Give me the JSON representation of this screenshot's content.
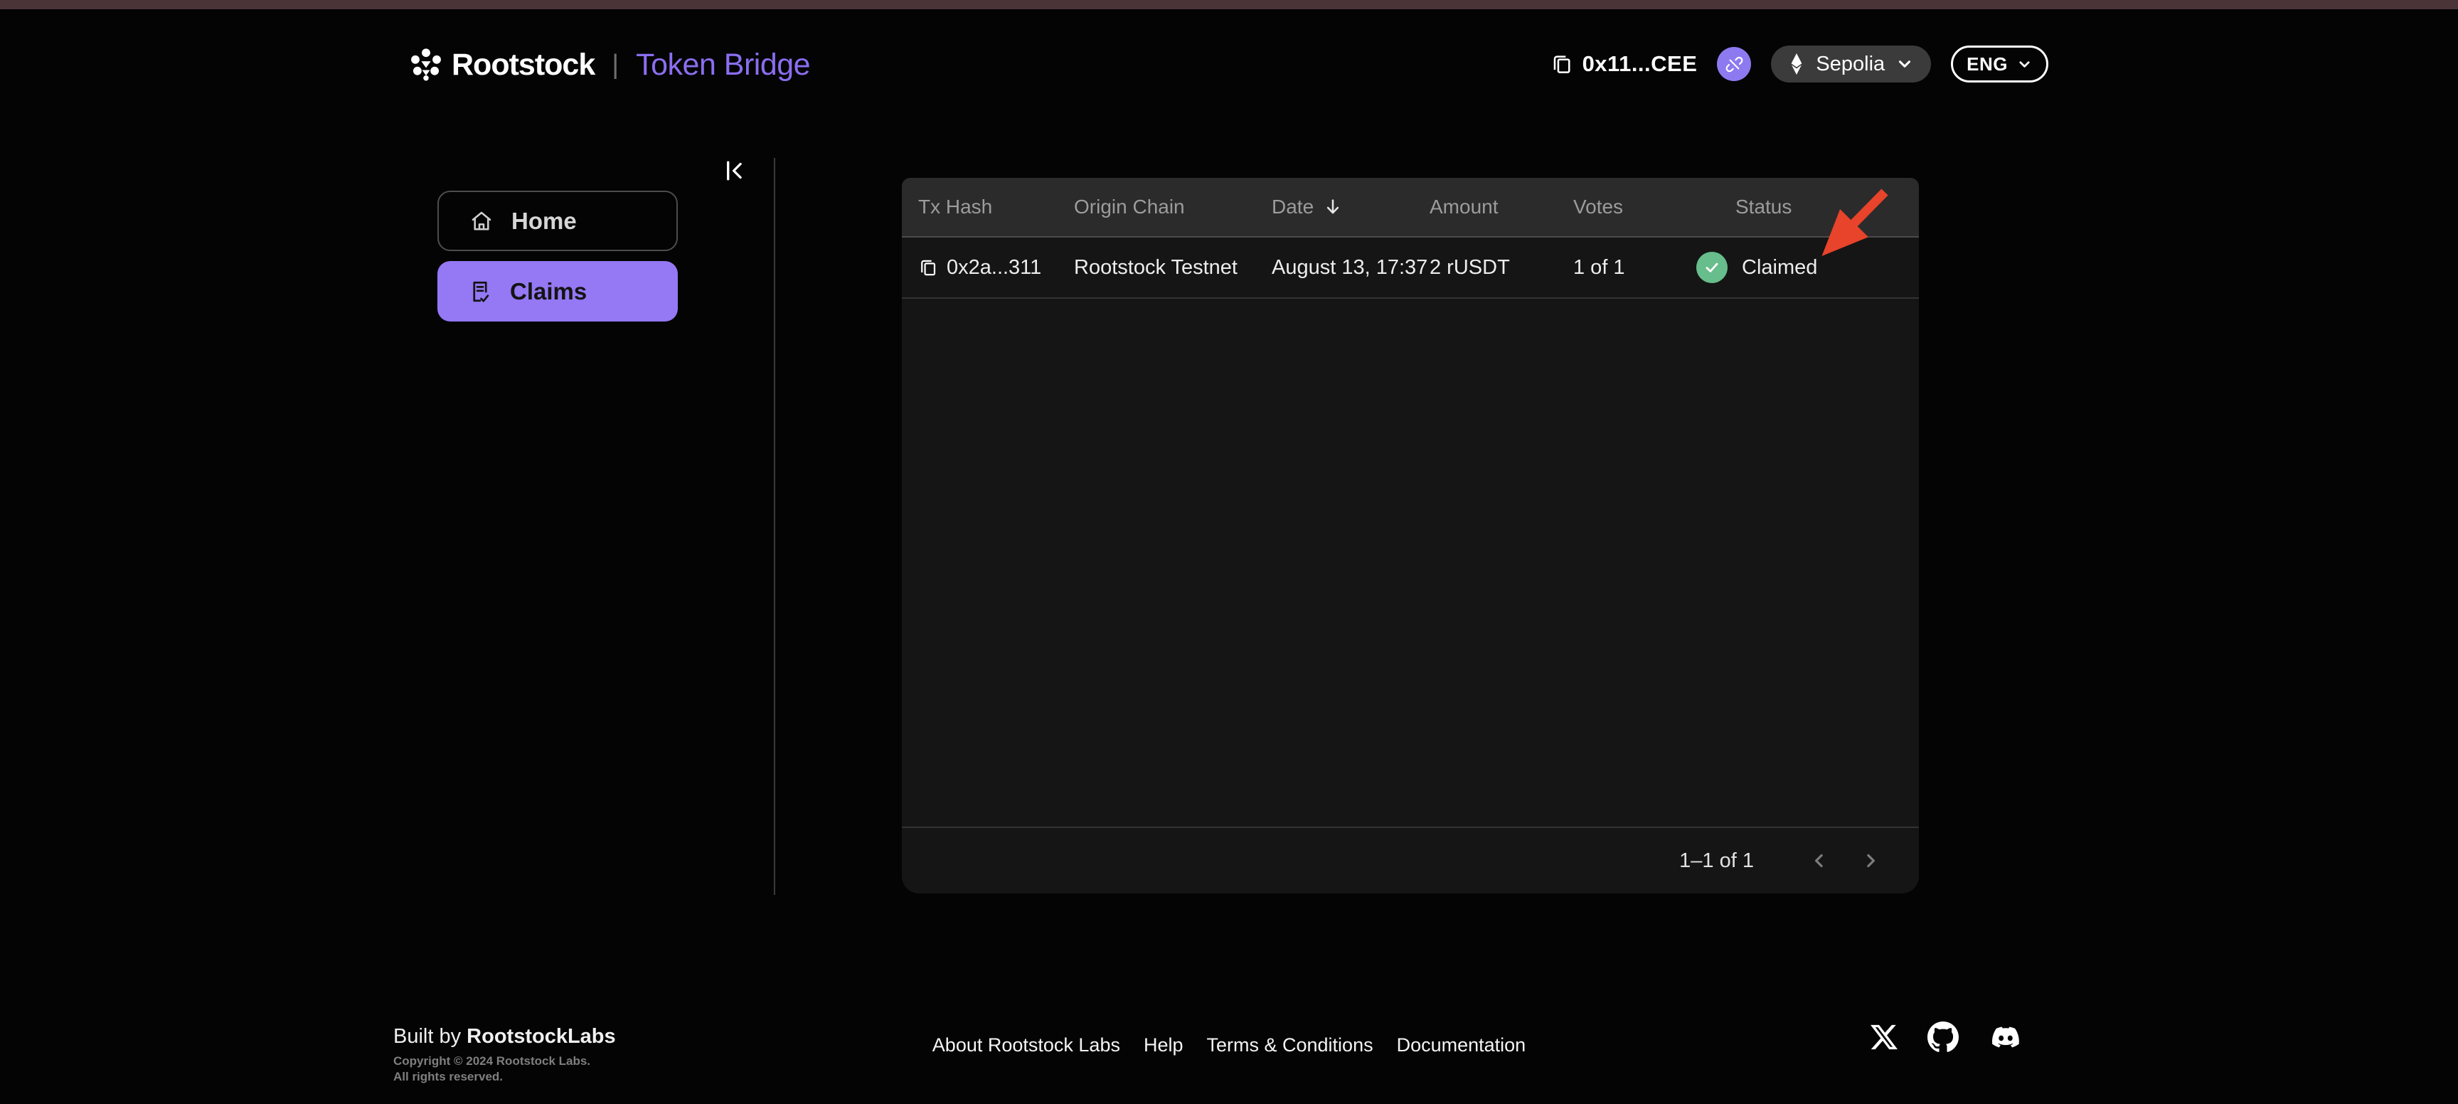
{
  "brand": {
    "name": "Rootstock",
    "app": "Token Bridge",
    "separator": "|"
  },
  "header": {
    "wallet_address": "0x11...CEE",
    "network": {
      "label": "Sepolia"
    },
    "language": {
      "label": "ENG"
    }
  },
  "sidebar": {
    "items": [
      {
        "label": "Home",
        "active": false
      },
      {
        "label": "Claims",
        "active": true
      }
    ]
  },
  "table": {
    "columns": [
      "Tx Hash",
      "Origin Chain",
      "Date",
      "Amount",
      "Votes",
      "Status"
    ],
    "sorted_column": "Date",
    "sort_direction": "desc",
    "rows": [
      {
        "tx_hash": "0x2a...311",
        "origin_chain": "Rootstock Testnet",
        "date": "August 13, 17:37",
        "amount": "2 rUSDT",
        "votes": "1 of 1",
        "status": "Claimed"
      }
    ],
    "pagination": {
      "range_label": "1–1 of 1"
    }
  },
  "annotation": {
    "red_arrow_points_at": "Claimed"
  },
  "footer": {
    "built_by_prefix": "Built by ",
    "built_by_brand": "RootstockLabs",
    "copyright_line1": "Copyright © 2024 Rootstock Labs.",
    "copyright_line2": "All rights reserved.",
    "links": [
      "About Rootstock Labs",
      "Help",
      "Terms & Conditions",
      "Documentation"
    ]
  },
  "icons": {
    "rootstock-logo-icon": "flower-of-dots",
    "copy-icon": "⧉",
    "disconnect-icon": "broken-chain-link",
    "ethereum-icon": "◆",
    "chevron-down-icon": "⌄",
    "collapse-sidebar-icon": "|<",
    "home-icon": "⌂",
    "claims-icon": "document-check",
    "sort-desc-icon": "↓",
    "check-icon": "✓",
    "chevron-left-icon": "‹",
    "chevron-right-icon": "›",
    "x-icon": "X",
    "github-icon": "octocat",
    "discord-icon": "discord-blob"
  },
  "colors": {
    "accent_purple": "#9478f4",
    "brand_purple_text": "#8b6ef0",
    "status_green": "#67bd8b",
    "annotation_red": "#e8432b",
    "topstrip": "#4a3438",
    "table_header_bg": "#2b2b2b",
    "card_bg": "#151515"
  }
}
